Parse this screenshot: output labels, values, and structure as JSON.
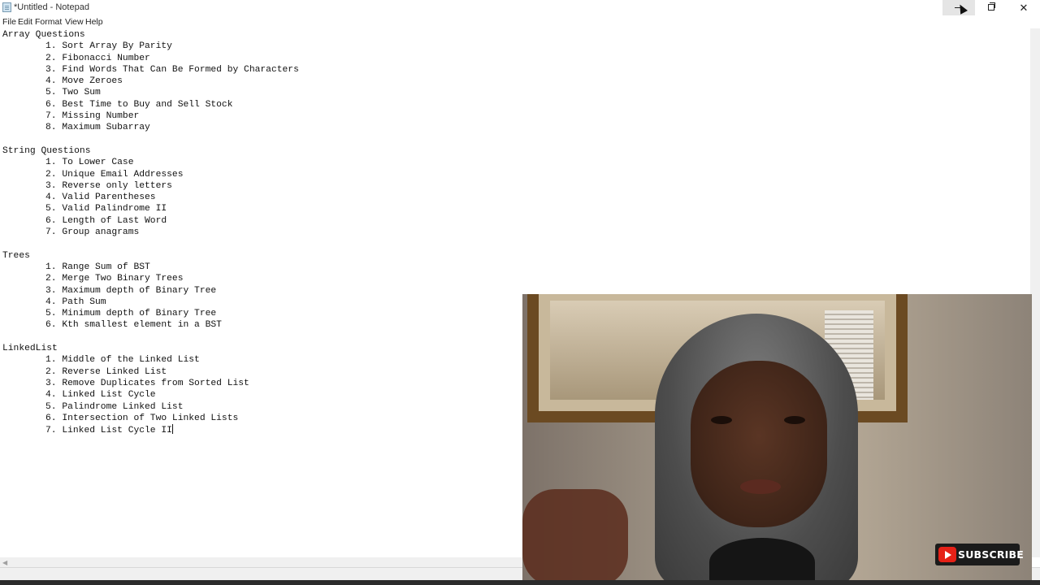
{
  "window": {
    "title": "*Untitled - Notepad",
    "icon": "notepad-icon",
    "controls": {
      "minimize": "minimize-icon",
      "maximize": "restore-icon",
      "close": "✕"
    }
  },
  "menu": {
    "items": [
      "File",
      "Edit",
      "Format",
      "View",
      "Help"
    ]
  },
  "document": {
    "sections": [
      {
        "heading": "Array Questions",
        "items": [
          "1. Sort Array By Parity",
          "2. Fibonacci Number",
          "3. Find Words That Can Be Formed by Characters",
          "4. Move Zeroes",
          "5. Two Sum",
          "6. Best Time to Buy and Sell Stock",
          "7. Missing Number",
          "8. Maximum Subarray"
        ]
      },
      {
        "heading": "String Questions",
        "items": [
          "1. To Lower Case",
          "2. Unique Email Addresses",
          "3. Reverse only letters",
          "4. Valid Parentheses",
          "5. Valid Palindrome II",
          "6. Length of Last Word",
          "7. Group anagrams"
        ]
      },
      {
        "heading": "Trees",
        "items": [
          "1. Range Sum of BST",
          "2. Merge Two Binary Trees",
          "3. Maximum depth of Binary Tree",
          "4. Path Sum",
          "5. Minimum depth of Binary Tree",
          "6. Kth smallest element in a BST"
        ]
      },
      {
        "heading": "LinkedList",
        "items": [
          "1. Middle of the Linked List",
          "2. Reverse Linked List",
          "3. Remove Duplicates from Sorted List",
          "4. Linked List Cycle",
          "5. Palindrome Linked List",
          "6. Intersection of Two Linked Lists",
          "7. Linked List Cycle II"
        ]
      }
    ]
  },
  "overlay": {
    "subscribe_label": "SUBSCRIBE",
    "subscribe_icon": "youtube-play-icon",
    "accent": "#e62117"
  }
}
